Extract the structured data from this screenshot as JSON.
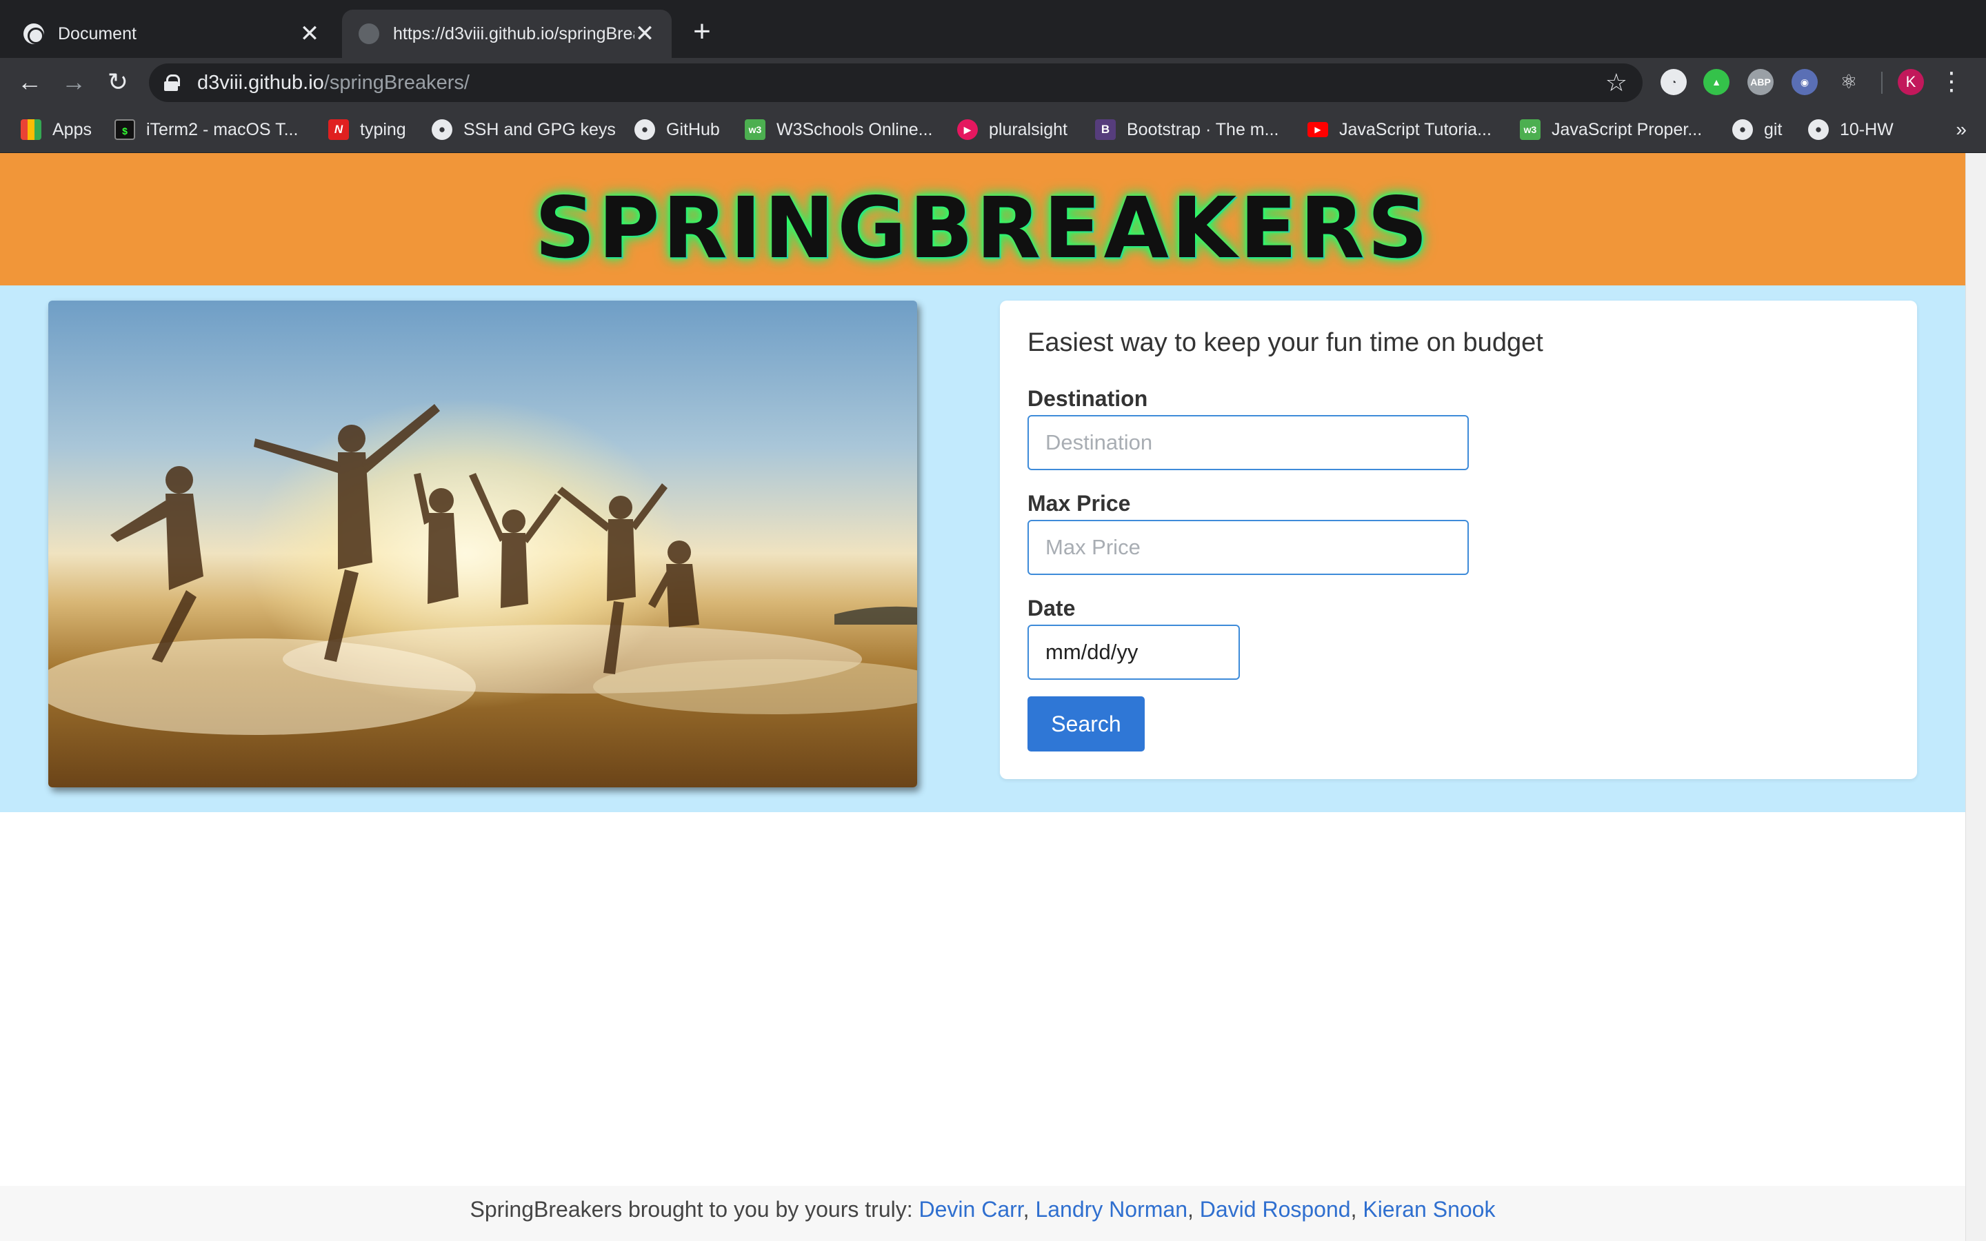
{
  "browser": {
    "tabs": [
      {
        "title": "Document",
        "active": false
      },
      {
        "title": "https://d3viii.github.io/springBreakers/",
        "active": true
      }
    ],
    "close_glyph": "✕",
    "new_tab_glyph": "+",
    "url_host": "d3viii.github.io",
    "url_path": "/springBreakers/",
    "profile_initial": "K",
    "bookmarks": [
      {
        "label": "Apps",
        "icon": "apps-grid-icon"
      },
      {
        "label": "iTerm2 - macOS T...",
        "icon": "terminal-icon"
      },
      {
        "label": "typing",
        "icon": "n-logo-icon"
      },
      {
        "label": "SSH and GPG keys",
        "icon": "github-icon"
      },
      {
        "label": "GitHub",
        "icon": "github-icon"
      },
      {
        "label": "W3Schools Online...",
        "icon": "w3schools-icon"
      },
      {
        "label": "pluralsight",
        "icon": "pluralsight-icon"
      },
      {
        "label": "Bootstrap · The m...",
        "icon": "bootstrap-icon"
      },
      {
        "label": "JavaScript Tutoria...",
        "icon": "youtube-icon"
      },
      {
        "label": "JavaScript Proper...",
        "icon": "w3schools-icon"
      },
      {
        "label": "git",
        "icon": "github-icon"
      },
      {
        "label": "10-HW",
        "icon": "github-icon"
      }
    ],
    "more_glyph": "»"
  },
  "header": {
    "logo": "SPRINGBREAKERS"
  },
  "form": {
    "title": "Easiest way to keep your fun time on budget",
    "destination_label": "Destination",
    "destination_placeholder": "Destination",
    "max_price_label": "Max Price",
    "max_price_placeholder": "Max Price",
    "date_label": "Date",
    "date_value": "mm/dd/yy",
    "search_label": "Search"
  },
  "footer": {
    "prefix": "SpringBreakers brought to you by yours truly: ",
    "authors": [
      "Devin Carr",
      "Landry Norman",
      "David Rospond",
      "Kieran Snook"
    ],
    "separator": ", "
  },
  "colors": {
    "header_bg": "#f19639",
    "hero_bg": "#c2eafd",
    "button_bg": "#2f77d6",
    "link": "#2f6fcf"
  }
}
